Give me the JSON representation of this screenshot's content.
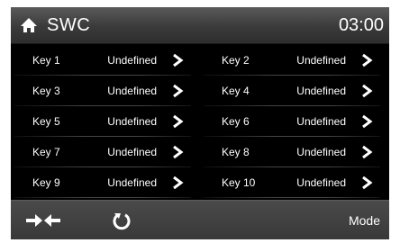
{
  "header": {
    "home_icon": "home-icon",
    "title": "SWC",
    "clock": "03:00"
  },
  "keys": [
    {
      "label": "Key 1",
      "value": "Undefined"
    },
    {
      "label": "Key 2",
      "value": "Undefined"
    },
    {
      "label": "Key 3",
      "value": "Undefined"
    },
    {
      "label": "Key 4",
      "value": "Undefined"
    },
    {
      "label": "Key 5",
      "value": "Undefined"
    },
    {
      "label": "Key 6",
      "value": "Undefined"
    },
    {
      "label": "Key 7",
      "value": "Undefined"
    },
    {
      "label": "Key 8",
      "value": "Undefined"
    },
    {
      "label": "Key 9",
      "value": "Undefined"
    },
    {
      "label": "Key 10",
      "value": "Undefined"
    }
  ],
  "footer": {
    "swap_icon": "swap-arrows-icon",
    "reset_icon": "reset-icon",
    "mode_label": "Mode"
  },
  "colors": {
    "background": "#000000",
    "text": "#ffffff",
    "bar": "#3a3a3a"
  }
}
